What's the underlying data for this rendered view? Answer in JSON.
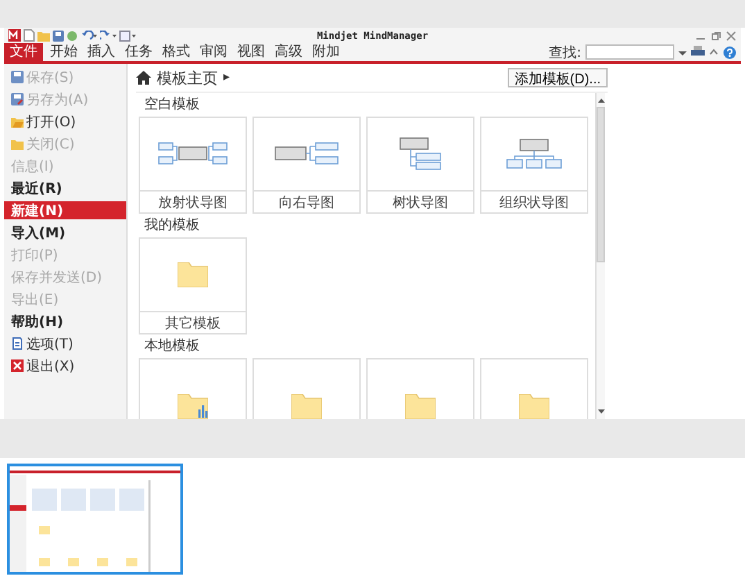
{
  "window": {
    "title": "Mindjet MindManager"
  },
  "menu_tabs": [
    {
      "label": "文件",
      "selected": true
    },
    {
      "label": "开始",
      "selected": false
    },
    {
      "label": "插入",
      "selected": false
    },
    {
      "label": "任务",
      "selected": false
    },
    {
      "label": "格式",
      "selected": false
    },
    {
      "label": "审阅",
      "selected": false
    },
    {
      "label": "视图",
      "selected": false
    },
    {
      "label": "高级",
      "selected": false
    },
    {
      "label": "附加",
      "selected": false
    }
  ],
  "search": {
    "label": "查找:"
  },
  "sidebar": {
    "items": [
      {
        "label": "保存(S)",
        "kind": "command",
        "disabled": true,
        "selected": false
      },
      {
        "label": "另存为(A)",
        "kind": "command",
        "disabled": true,
        "selected": false
      },
      {
        "label": "打开(O)",
        "kind": "command",
        "disabled": false,
        "selected": false
      },
      {
        "label": "关闭(C)",
        "kind": "command",
        "disabled": true,
        "selected": false
      },
      {
        "label": "信息(I)",
        "kind": "heading",
        "disabled": true,
        "selected": false
      },
      {
        "label": "最近(R)",
        "kind": "heading",
        "disabled": false,
        "selected": false
      },
      {
        "label": "新建(N)",
        "kind": "heading",
        "disabled": false,
        "selected": true
      },
      {
        "label": "导入(M)",
        "kind": "heading",
        "disabled": false,
        "selected": false
      },
      {
        "label": "打印(P)",
        "kind": "heading",
        "disabled": true,
        "selected": false
      },
      {
        "label": "保存并发送(D)",
        "kind": "heading",
        "disabled": true,
        "selected": false
      },
      {
        "label": "导出(E)",
        "kind": "heading",
        "disabled": true,
        "selected": false
      },
      {
        "label": "帮助(H)",
        "kind": "heading",
        "disabled": false,
        "selected": false
      },
      {
        "label": "选项(T)",
        "kind": "command",
        "disabled": false,
        "selected": false
      },
      {
        "label": "退出(X)",
        "kind": "command",
        "disabled": false,
        "selected": false
      }
    ]
  },
  "breadcrumb": {
    "label": "模板主页",
    "arrow": "▸"
  },
  "add_template_button": "添加模板(D)...",
  "sections": [
    {
      "title": "空白模板",
      "cards": [
        {
          "label": "放射状导图",
          "kind": "radial"
        },
        {
          "label": "向右导图",
          "kind": "right"
        },
        {
          "label": "树状导图",
          "kind": "tree"
        },
        {
          "label": "组织状导图",
          "kind": "org"
        }
      ]
    },
    {
      "title": "我的模板",
      "cards": [
        {
          "label": "其它模板",
          "kind": "folder"
        }
      ]
    },
    {
      "title": "本地模板",
      "cards": [
        {
          "kind": "chart-folder"
        },
        {
          "kind": "folder"
        },
        {
          "kind": "folder"
        },
        {
          "kind": "folder"
        }
      ]
    }
  ]
}
